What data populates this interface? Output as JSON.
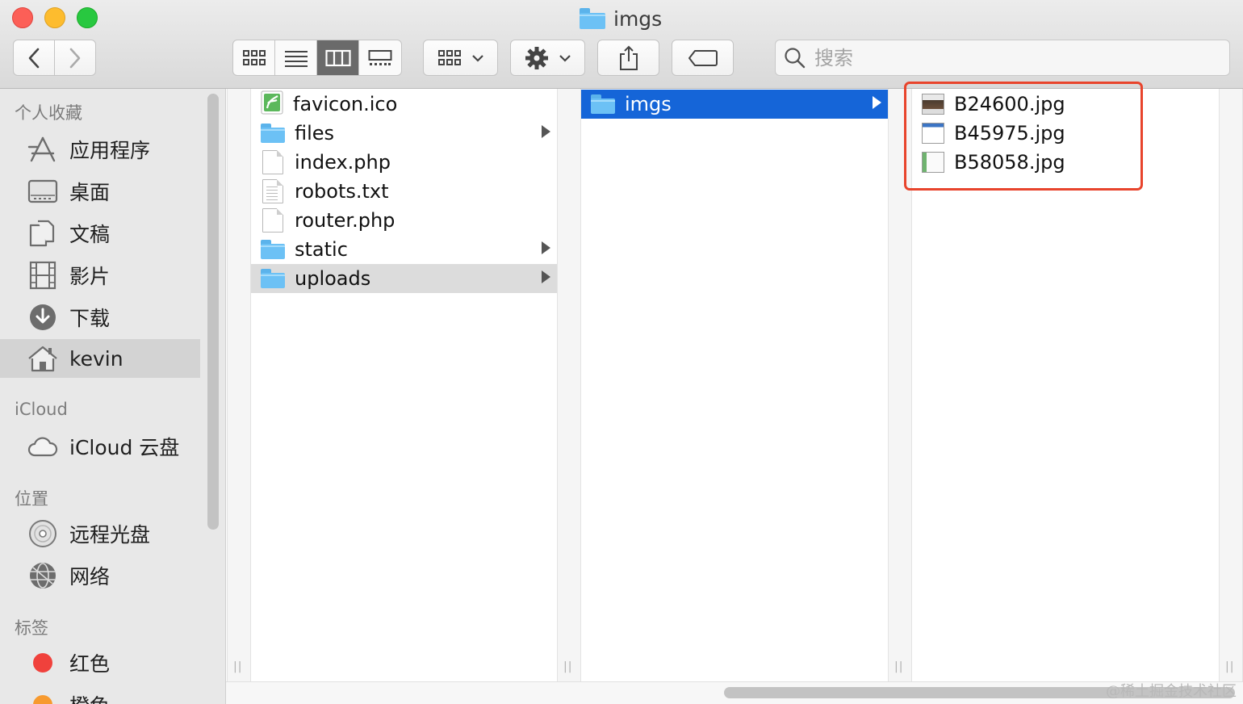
{
  "window": {
    "title": "imgs"
  },
  "toolbar": {
    "view_buttons": [
      "icon-view",
      "list-view",
      "column-view",
      "gallery-view"
    ],
    "active_view": "column-view",
    "search": {
      "placeholder": "搜索",
      "value": ""
    }
  },
  "sidebar": {
    "sections": {
      "favorites": "个人收藏",
      "icloud": "iCloud",
      "locations": "位置",
      "tags": "标签"
    },
    "favorites": [
      {
        "label": "应用程序",
        "icon": "applications-icon"
      },
      {
        "label": "桌面",
        "icon": "desktop-icon"
      },
      {
        "label": "文稿",
        "icon": "documents-icon"
      },
      {
        "label": "影片",
        "icon": "movies-icon"
      },
      {
        "label": "下载",
        "icon": "downloads-icon"
      },
      {
        "label": "kevin",
        "icon": "home-icon",
        "selected": true
      }
    ],
    "icloud": [
      {
        "label": "iCloud 云盘",
        "icon": "cloud-icon"
      }
    ],
    "locations": [
      {
        "label": "远程光盘",
        "icon": "disc-icon"
      },
      {
        "label": "网络",
        "icon": "network-icon"
      }
    ],
    "tags": [
      {
        "label": "红色",
        "color": "#f0413c"
      },
      {
        "label": "橙色",
        "color": "#f79a2f"
      }
    ]
  },
  "columns": [
    {
      "items": [
        {
          "name": "favicon.ico",
          "type": "ico"
        },
        {
          "name": "files",
          "type": "folder"
        },
        {
          "name": "index.php",
          "type": "doc"
        },
        {
          "name": "robots.txt",
          "type": "text"
        },
        {
          "name": "router.php",
          "type": "doc"
        },
        {
          "name": "static",
          "type": "folder"
        },
        {
          "name": "uploads",
          "type": "folder",
          "selected": true
        }
      ]
    },
    {
      "items": [
        {
          "name": "imgs",
          "type": "folder",
          "selected": true
        }
      ]
    },
    {
      "items": [
        {
          "name": "B24600.jpg",
          "type": "image"
        },
        {
          "name": "B45975.jpg",
          "type": "image"
        },
        {
          "name": "B58058.jpg",
          "type": "image"
        }
      ]
    }
  ],
  "watermark": "@稀土掘金技术社区"
}
